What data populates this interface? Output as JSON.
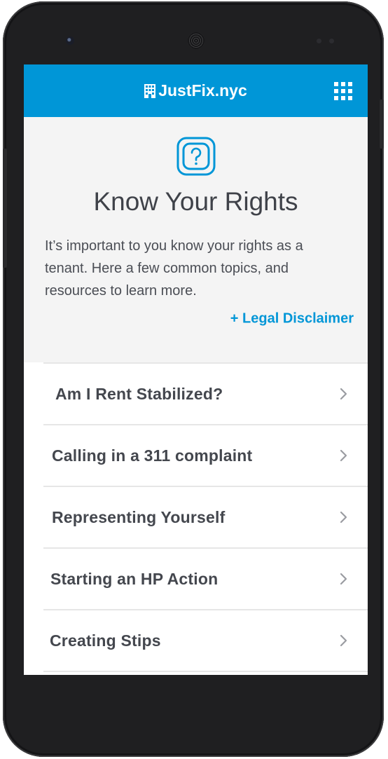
{
  "header": {
    "brand": "JustFix.nyc",
    "brand_icon": "building-icon",
    "menu_icon": "grid-menu-icon"
  },
  "colors": {
    "brand_blue": "#0096d7",
    "hero_bg": "#f4f4f4",
    "text_dark": "#3f4249"
  },
  "hero": {
    "icon": "question-icon",
    "title": "Know Your Rights",
    "description": "It’s important to you know your rights as a tenant. Here a few common topics, and resources to learn more.",
    "disclaimer_link": "+ Legal Disclaimer"
  },
  "topics": [
    {
      "label": "Am I Rent Stabilized?"
    },
    {
      "label": "Calling in a 311 complaint"
    },
    {
      "label": "Representing Yourself"
    },
    {
      "label": "Starting an HP Action"
    },
    {
      "label": "Creating Stips"
    }
  ]
}
